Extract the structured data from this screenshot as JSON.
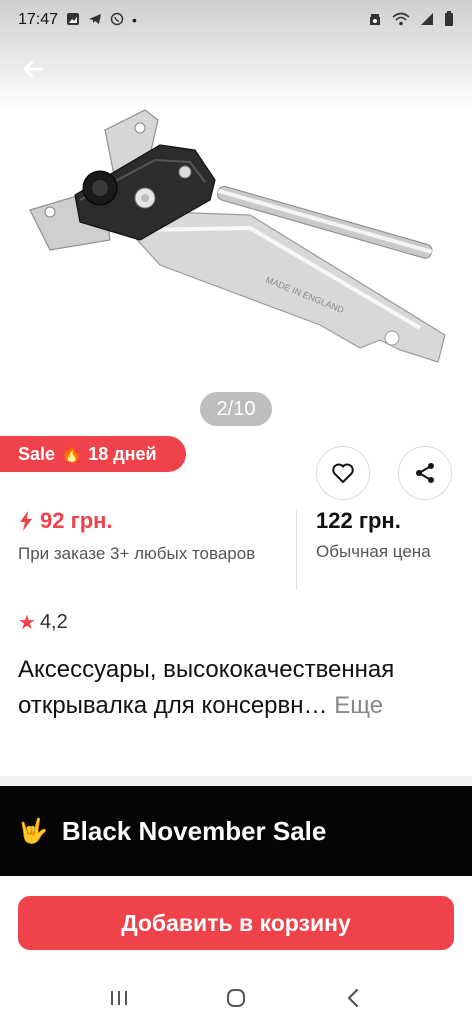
{
  "status_bar": {
    "time": "17:47",
    "icons": [
      "gallery-icon",
      "telegram-icon",
      "viber-icon",
      "dot-icon",
      "alarm-icon",
      "wifi-icon",
      "signal-icon",
      "battery-icon"
    ]
  },
  "gallery": {
    "counter": "2/10",
    "image_label": "MADE IN ENGLAND"
  },
  "sale_badge": {
    "label": "Sale",
    "fire_icon": "🔥",
    "days": "18 дней"
  },
  "prices": {
    "promo_price": "92 грн.",
    "promo_note": "При заказе 3+ любых товаров",
    "regular_price": "122 грн.",
    "regular_note": "Обычная цена"
  },
  "rating": {
    "value": "4,2"
  },
  "product": {
    "title": "Аксессуары, высококачественная открывалка для консервн…",
    "more_label": "Еще"
  },
  "promo_banner": {
    "emoji": "🤟",
    "text": "Black November Sale"
  },
  "cart": {
    "button_label": "Добавить в корзину"
  },
  "colors": {
    "accent": "#f0424a",
    "banner_bg": "#050505",
    "muted_text": "#555555"
  }
}
